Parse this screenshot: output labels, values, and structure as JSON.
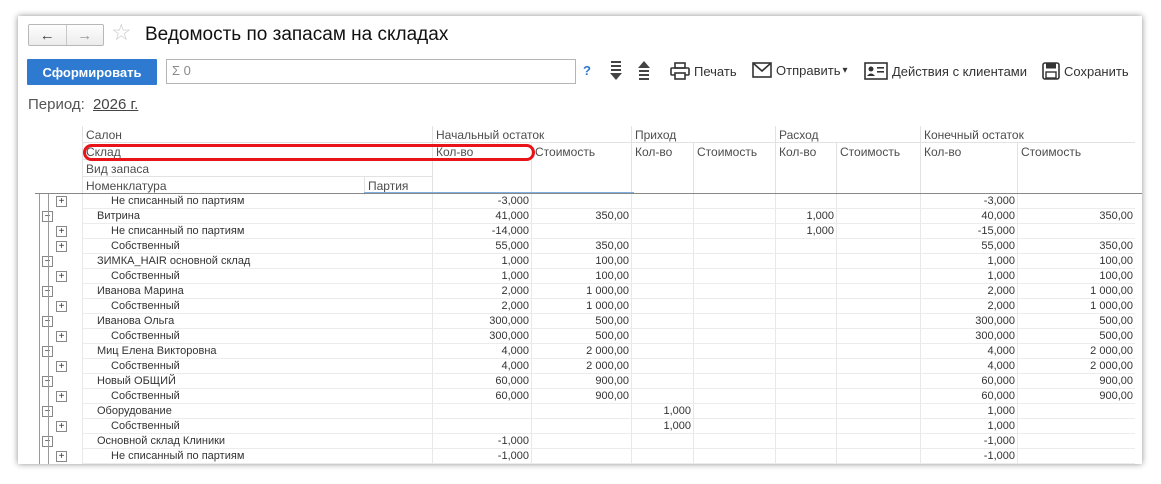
{
  "window": {
    "title": "Ведомость по запасам на складах",
    "back_icon": "←",
    "forward_icon": "→",
    "star_icon": "☆"
  },
  "toolbar": {
    "generate_label": "Сформировать",
    "sum_value": "Σ 0",
    "help_label": "?",
    "print_label": "Печать",
    "send_label": "Отправить",
    "send_arrow": "▾",
    "client_actions_label": "Действия с клиентами",
    "save_label": "Сохранить"
  },
  "period": {
    "label": "Период:",
    "value": "2026 г."
  },
  "header": {
    "salon": "Салон",
    "sklad": "Склад",
    "vid_zapasa": "Вид запаса",
    "nomenklatura": "Номенклатура",
    "partiya": "Партия",
    "nachalny": "Начальный остаток",
    "prihod": "Приход",
    "rashod": "Расход",
    "konechny": "Конечный остаток",
    "kolvo": "Кол-во",
    "stoimost": "Стоимость"
  },
  "rows": [
    {
      "level": 2,
      "toggle": "+",
      "name": "Не списанный по партиям",
      "nq": "-3,000",
      "ns": "",
      "pq": "",
      "ps": "",
      "rq": "",
      "rs": "",
      "kq": "-3,000",
      "ks": ""
    },
    {
      "level": 1,
      "toggle": "−",
      "name": "Витрина",
      "nq": "41,000",
      "ns": "350,00",
      "pq": "",
      "ps": "",
      "rq": "1,000",
      "rs": "",
      "kq": "40,000",
      "ks": "350,00"
    },
    {
      "level": 2,
      "toggle": "+",
      "name": "Не списанный по партиям",
      "nq": "-14,000",
      "ns": "",
      "pq": "",
      "ps": "",
      "rq": "1,000",
      "rs": "",
      "kq": "-15,000",
      "ks": ""
    },
    {
      "level": 2,
      "toggle": "+",
      "name": "Собственный",
      "nq": "55,000",
      "ns": "350,00",
      "pq": "",
      "ps": "",
      "rq": "",
      "rs": "",
      "kq": "55,000",
      "ks": "350,00"
    },
    {
      "level": 1,
      "toggle": "−",
      "name": "ЗИМКА_HAIR основной склад",
      "nq": "1,000",
      "ns": "100,00",
      "pq": "",
      "ps": "",
      "rq": "",
      "rs": "",
      "kq": "1,000",
      "ks": "100,00"
    },
    {
      "level": 2,
      "toggle": "+",
      "name": "Собственный",
      "nq": "1,000",
      "ns": "100,00",
      "pq": "",
      "ps": "",
      "rq": "",
      "rs": "",
      "kq": "1,000",
      "ks": "100,00"
    },
    {
      "level": 1,
      "toggle": "−",
      "name": "Иванова Марина",
      "nq": "2,000",
      "ns": "1 000,00",
      "pq": "",
      "ps": "",
      "rq": "",
      "rs": "",
      "kq": "2,000",
      "ks": "1 000,00"
    },
    {
      "level": 2,
      "toggle": "+",
      "name": "Собственный",
      "nq": "2,000",
      "ns": "1 000,00",
      "pq": "",
      "ps": "",
      "rq": "",
      "rs": "",
      "kq": "2,000",
      "ks": "1 000,00"
    },
    {
      "level": 1,
      "toggle": "−",
      "name": "Иванова Ольга",
      "nq": "300,000",
      "ns": "500,00",
      "pq": "",
      "ps": "",
      "rq": "",
      "rs": "",
      "kq": "300,000",
      "ks": "500,00"
    },
    {
      "level": 2,
      "toggle": "+",
      "name": "Собственный",
      "nq": "300,000",
      "ns": "500,00",
      "pq": "",
      "ps": "",
      "rq": "",
      "rs": "",
      "kq": "300,000",
      "ks": "500,00"
    },
    {
      "level": 1,
      "toggle": "−",
      "name": "Миц Елена Викторовна",
      "nq": "4,000",
      "ns": "2 000,00",
      "pq": "",
      "ps": "",
      "rq": "",
      "rs": "",
      "kq": "4,000",
      "ks": "2 000,00"
    },
    {
      "level": 2,
      "toggle": "+",
      "name": "Собственный",
      "nq": "4,000",
      "ns": "2 000,00",
      "pq": "",
      "ps": "",
      "rq": "",
      "rs": "",
      "kq": "4,000",
      "ks": "2 000,00"
    },
    {
      "level": 1,
      "toggle": "−",
      "name": "Новый ОБЩИЙ",
      "nq": "60,000",
      "ns": "900,00",
      "pq": "",
      "ps": "",
      "rq": "",
      "rs": "",
      "kq": "60,000",
      "ks": "900,00"
    },
    {
      "level": 2,
      "toggle": "+",
      "name": "Собственный",
      "nq": "60,000",
      "ns": "900,00",
      "pq": "",
      "ps": "",
      "rq": "",
      "rs": "",
      "kq": "60,000",
      "ks": "900,00"
    },
    {
      "level": 1,
      "toggle": "−",
      "name": "Оборудование",
      "nq": "",
      "ns": "",
      "pq": "1,000",
      "ps": "",
      "rq": "",
      "rs": "",
      "kq": "1,000",
      "ks": ""
    },
    {
      "level": 2,
      "toggle": "+",
      "name": "Собственный",
      "nq": "",
      "ns": "",
      "pq": "1,000",
      "ps": "",
      "rq": "",
      "rs": "",
      "kq": "1,000",
      "ks": ""
    },
    {
      "level": 1,
      "toggle": "−",
      "name": "Основной склад Клиники",
      "nq": "-1,000",
      "ns": "",
      "pq": "",
      "ps": "",
      "rq": "",
      "rs": "",
      "kq": "-1,000",
      "ks": ""
    },
    {
      "level": 2,
      "toggle": "+",
      "name": "Не списанный по партиям",
      "nq": "-1,000",
      "ns": "",
      "pq": "",
      "ps": "",
      "rq": "",
      "rs": "",
      "kq": "-1,000",
      "ks": ""
    }
  ],
  "colors": {
    "accent": "#2f7ad1",
    "highlight": "#e8141a"
  }
}
